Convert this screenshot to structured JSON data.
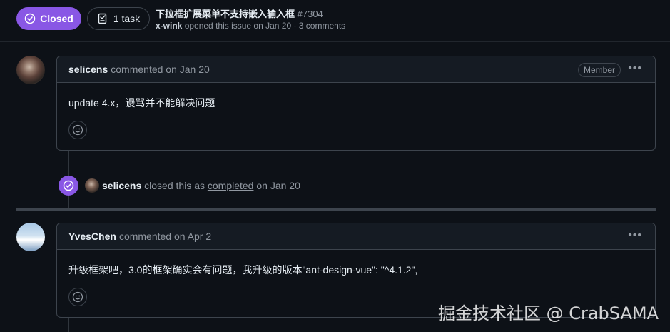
{
  "issue": {
    "state": "Closed",
    "tasks_label": "1 task",
    "title": "下拉框扩展菜单不支持嵌入输入框",
    "number": "#7304",
    "author": "x-wink",
    "meta": "opened this issue on Jan 20 · 3 comments",
    "state_color": "#8957e5"
  },
  "comments": [
    {
      "author": "selicens",
      "meta": "commented on Jan 20",
      "badge": "Member",
      "body": "update 4.x，谩骂并不能解决问题",
      "avatar": "avatar-image"
    },
    {
      "author": "YvesChen",
      "meta": "commented on Apr 2",
      "body": "升级框架吧，3.0的框架确实会有问题，我升级的版本\"ant-design-vue\": \"^4.1.2\",",
      "avatar": "avatar-image"
    }
  ],
  "event": {
    "actor": "selicens",
    "pre": "closed this as",
    "link": "completed",
    "post": "on Jan 20",
    "icon": "check-circle-icon"
  },
  "watermark": "掘金技术社区 @ CrabSAMA"
}
